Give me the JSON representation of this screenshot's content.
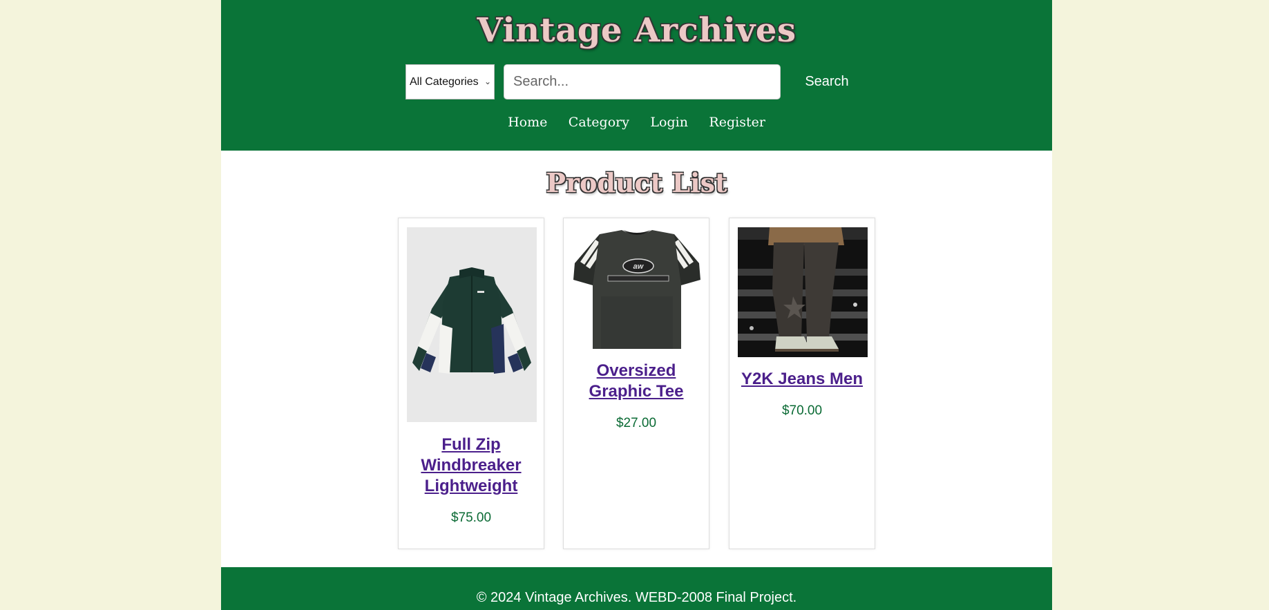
{
  "site": {
    "title": "Vintage Archives"
  },
  "search": {
    "category_selected": "All Categories",
    "placeholder": "Search...",
    "button_label": "Search"
  },
  "nav": {
    "home": "Home",
    "category": "Category",
    "login": "Login",
    "register": "Register"
  },
  "main": {
    "title": "Product List",
    "products": [
      {
        "name": "Full Zip Windbreaker Lightweight",
        "price": "$75.00",
        "image": "windbreaker-jacket-image"
      },
      {
        "name": "Oversized Graphic Tee",
        "price": "$27.00",
        "image": "graphic-tee-image"
      },
      {
        "name": "Y2K Jeans Men",
        "price": "$70.00",
        "image": "y2k-jeans-image"
      }
    ]
  },
  "footer": {
    "text": "© 2024 Vintage Archives. WEBD-2008 Final Project."
  },
  "colors": {
    "header_green": "#0a7438",
    "page_background": "#f4f4dc",
    "title_pink": "#ecc9c6",
    "link_purple": "#4b1f8b",
    "price_green": "#0a6a34"
  }
}
